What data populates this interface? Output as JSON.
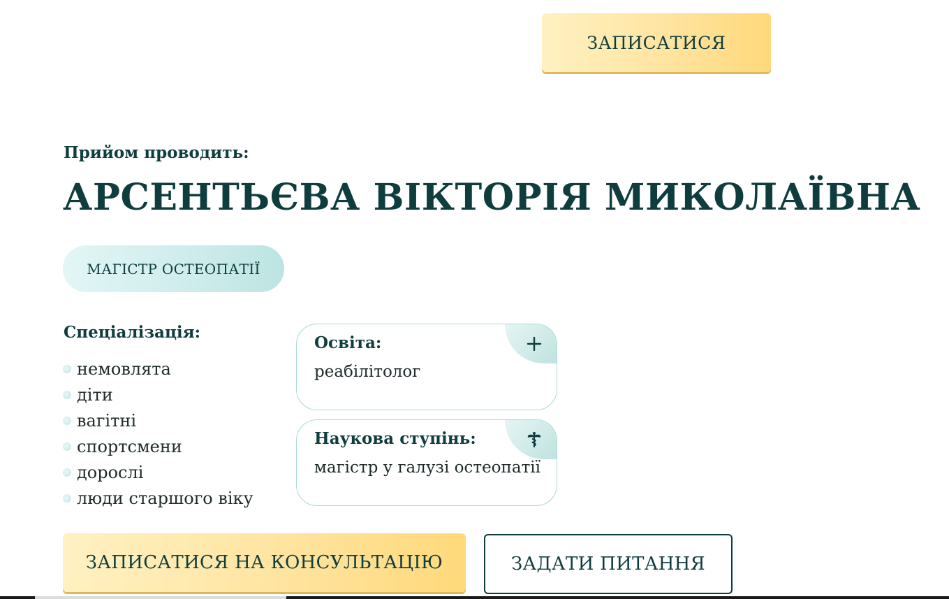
{
  "header": {
    "cta_label": "ЗАПИСАТИСЯ"
  },
  "doctor": {
    "conducts_label": "Прийом проводить:",
    "name": "АРСЕНТЬЄВА ВІКТОРІЯ МИКОЛАЇВНА",
    "title_badge": "МАГІСТР ОСТЕОПАТІЇ"
  },
  "specialization": {
    "title": "Спеціалізація:",
    "items": [
      "немовлята",
      "діти",
      "вагітні",
      "спортсмени",
      "дорослі",
      "люди старшого віку"
    ]
  },
  "cards": {
    "education": {
      "title": "Освіта:",
      "text": "реабілітолог",
      "icon": "plus-icon"
    },
    "degree": {
      "title": "Наукова ступінь:",
      "text": "магістр у галузі остеопатії",
      "icon": "caduceus-icon"
    }
  },
  "actions": {
    "consult_label": "ЗАПИСАТИСЯ НА КОНСУЛЬТАЦІЮ",
    "ask_label": "ЗАДАТИ ПИТАННЯ"
  },
  "colors": {
    "text_primary": "#0f3d3e",
    "gold_accent": "#ffd97a",
    "mint_accent": "#bde4e2"
  }
}
